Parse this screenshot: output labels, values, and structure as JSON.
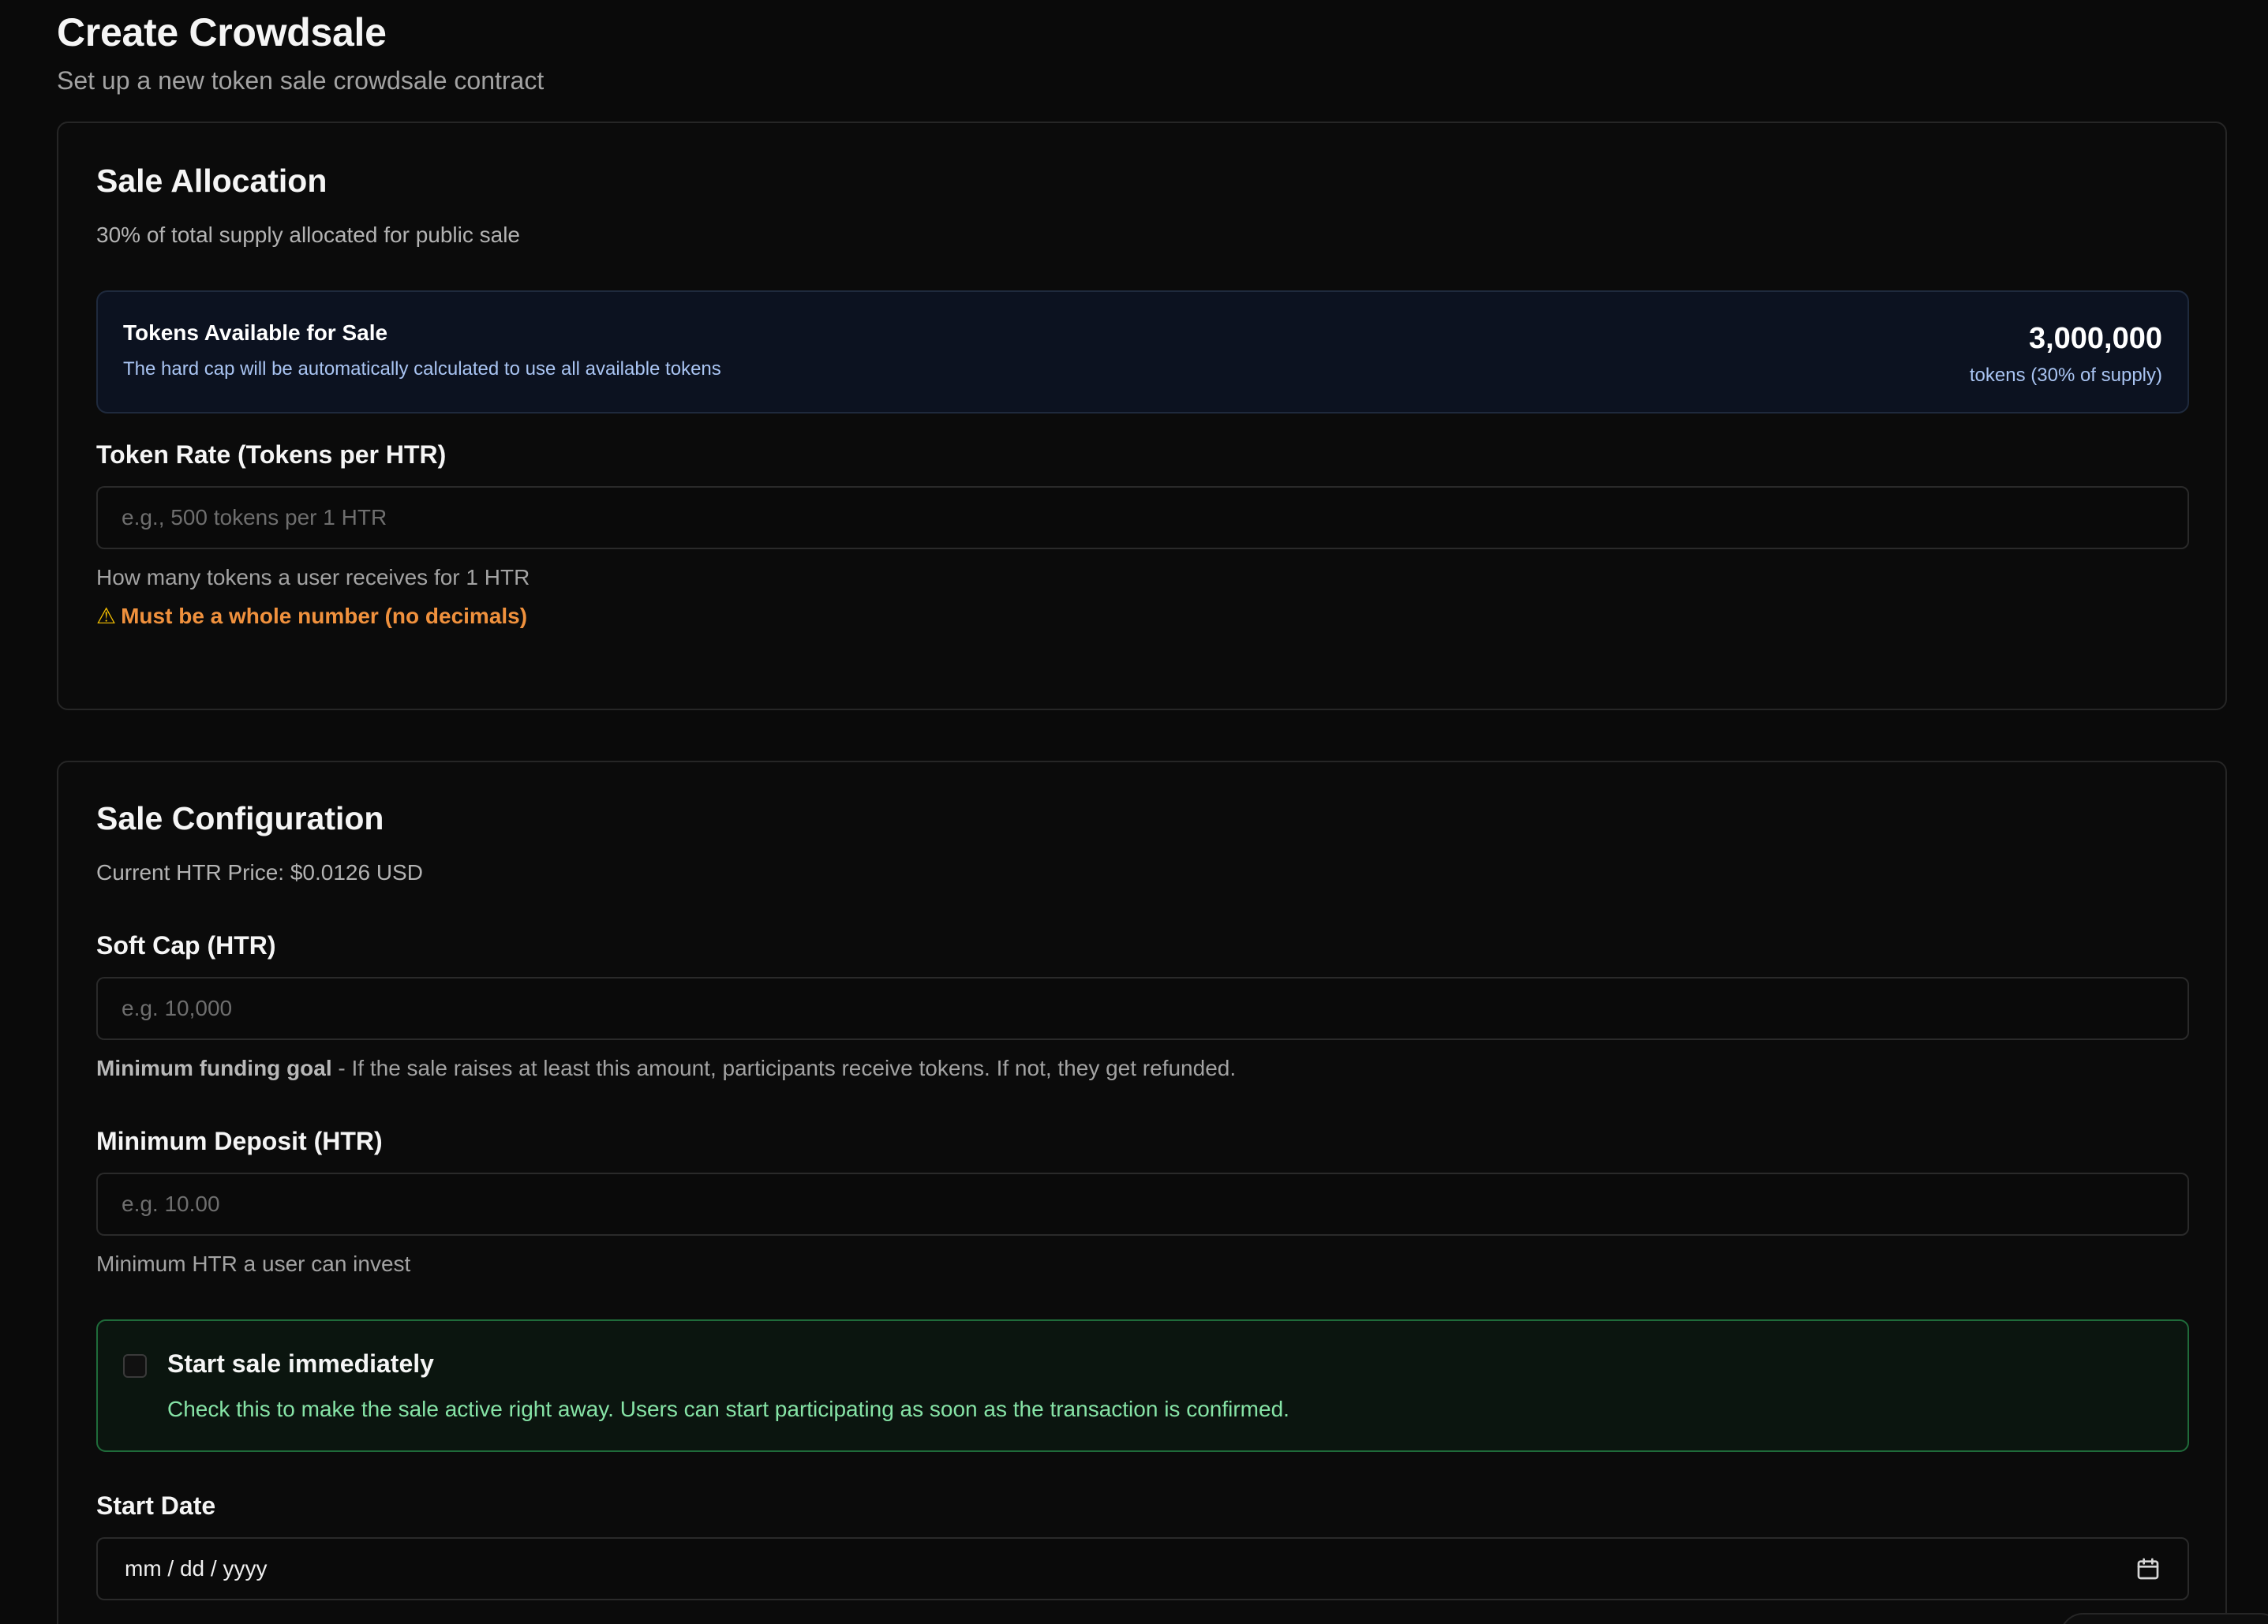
{
  "header": {
    "title": "Create Crowdsale",
    "subtitle": "Set up a new token sale crowdsale contract"
  },
  "sale_allocation": {
    "title": "Sale Allocation",
    "description": "30% of total supply allocated for public sale",
    "available_box": {
      "label": "Tokens Available for Sale",
      "hint": "The hard cap will be automatically calculated to use all available tokens",
      "amount": "3,000,000",
      "amount_sub": "tokens (30% of supply)"
    },
    "token_rate": {
      "label": "Token Rate (Tokens per HTR)",
      "placeholder": "e.g., 500 tokens per 1 HTR",
      "value": "",
      "help": "How many tokens a user receives for 1 HTR",
      "warning": "Must be a whole number (no decimals)",
      "warning_icon": "⚠"
    }
  },
  "sale_configuration": {
    "title": "Sale Configuration",
    "price_text": "Current HTR Price: $0.0126 USD",
    "soft_cap": {
      "label": "Soft Cap (HTR)",
      "placeholder": "e.g. 10,000",
      "value": "",
      "help_bold": "Minimum funding goal",
      "help_rest": " - If the sale raises at least this amount, participants receive tokens. If not, they get refunded."
    },
    "min_deposit": {
      "label": "Minimum Deposit (HTR)",
      "placeholder": "e.g. 10.00",
      "value": "",
      "help": "Minimum HTR a user can invest"
    },
    "start_immediately": {
      "checked": false,
      "title": "Start sale immediately",
      "description": "Check this to make the sale active right away. Users can start participating as soon as the transaction is confirmed."
    },
    "start_date": {
      "label": "Start Date",
      "value": "mm / dd / yyyy",
      "icon": "calendar-icon"
    }
  },
  "colors": {
    "background": "#0a0a0a",
    "warning": "#f0913d",
    "success_border": "#1f6b3a",
    "success_text": "#86e3a6",
    "info_text": "#a9c4f2"
  }
}
